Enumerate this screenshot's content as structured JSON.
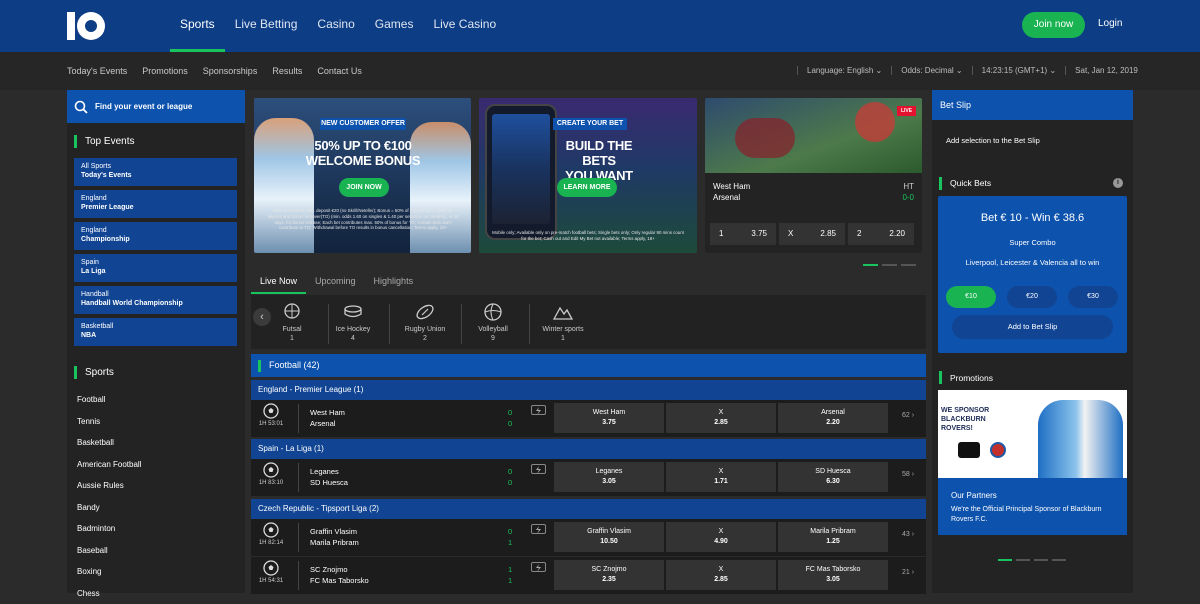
{
  "topbar": {
    "logo_text": "10 BET",
    "nav": [
      "Sports",
      "Live Betting",
      "Casino",
      "Games",
      "Live Casino"
    ],
    "join": "Join now",
    "login": "Login"
  },
  "subnav": {
    "links": [
      "Today's Events",
      "Promotions",
      "Sponsorships",
      "Results",
      "Contact Us"
    ],
    "language": "Language:  English",
    "odds": "Odds:  Decimal",
    "time": "14:23:15  (GMT+1)",
    "date": "Sat, Jan 12, 2019"
  },
  "left": {
    "search": "Find your event or league",
    "top_events_title": "Top Events",
    "events": [
      [
        "All Sports",
        "Today's Events"
      ],
      [
        "England",
        "Premier League"
      ],
      [
        "England",
        "Championship"
      ],
      [
        "Spain",
        "La Liga"
      ],
      [
        "Handball",
        "Handball World Championship"
      ],
      [
        "Basketball",
        "NBA"
      ]
    ],
    "sports_title": "Sports",
    "sports": [
      "Football",
      "Tennis",
      "Basketball",
      "American Football",
      "Aussie Rules",
      "Bandy",
      "Badminton",
      "Baseball",
      "Boxing",
      "Chess"
    ]
  },
  "banners": [
    {
      "tag": "NEW CUSTOMER OFFER",
      "h1": "50% UP TO €100",
      "h2": "WELCOME BONUS",
      "btn": "JOIN NOW",
      "fine": "New Customers; Min. deposit €20 (no Skrill/Neteller); Bonus = 50% of deposit up to €100; 6x deposit and bonus turnover(TO) (min. odds 1.60 on singles & 1.40 per selection on combos), in 30 days, for bonus release; Each bet contributes max. 50% of bonus for TO; Certain bets don't contribute to TO; Withdrawal before TO results in bonus cancellation; Terms apply, 18+"
    },
    {
      "tag": "CREATE YOUR BET",
      "h1": "BUILD THE BETS",
      "h2": "YOU WANT",
      "btn": "LEARN MORE",
      "fine": "Mobile only; Available only on pre-match football bets; Single bets only; Only regular 90 mins count for the bet; Cash out and Edit My Bet not available; Terms apply, 18+"
    }
  ],
  "live_card": {
    "badge": "LIVE",
    "home": "West Ham",
    "away": "Arsenal",
    "status": "HT",
    "score": "0-0",
    "odds": [
      [
        "1",
        "3.75"
      ],
      [
        "X",
        "2.85"
      ],
      [
        "2",
        "2.20"
      ]
    ]
  },
  "tabs": [
    "Live Now",
    "Upcoming",
    "Highlights"
  ],
  "sports_bar": [
    [
      "Futsal",
      "1"
    ],
    [
      "Ice Hockey",
      "4"
    ],
    [
      "Rugby Union",
      "2"
    ],
    [
      "Volleyball",
      "9"
    ],
    [
      "Winter sports",
      "1"
    ]
  ],
  "football_header": "Football (42)",
  "groups": [
    "England - Premier League (1)",
    "Spain - La Liga (1)",
    "Czech Republic - Tipsport Liga (2)"
  ],
  "matches": [
    {
      "time": "1H 53:01",
      "home": "West Ham",
      "away": "Arsenal",
      "sh": "0",
      "sa": "0",
      "o1": [
        "West Ham",
        "3.75"
      ],
      "ox": [
        "X",
        "2.85"
      ],
      "o2": [
        "Arsenal",
        "2.20"
      ],
      "more": "62 ›"
    },
    {
      "time": "1H 83:10",
      "home": "Leganes",
      "away": "SD Huesca",
      "sh": "0",
      "sa": "0",
      "o1": [
        "Leganes",
        "3.05"
      ],
      "ox": [
        "X",
        "1.71"
      ],
      "o2": [
        "SD Huesca",
        "6.30"
      ],
      "more": "58 ›"
    },
    {
      "time": "1H 82:14",
      "home": "Graffin Vlasim",
      "away": "Marila Pribram",
      "sh": "0",
      "sa": "1",
      "o1": [
        "Graffin Vlasim",
        "10.50"
      ],
      "ox": [
        "X",
        "4.90"
      ],
      "o2": [
        "Marila Pribram",
        "1.25"
      ],
      "more": "43 ›"
    },
    {
      "time": "1H 54:31",
      "home": "SC Znojmo",
      "away": "FC Mas Taborsko",
      "sh": "1",
      "sa": "1",
      "o1": [
        "SC Znojmo",
        "2.35"
      ],
      "ox": [
        "X",
        "2.85"
      ],
      "o2": [
        "FC Mas Taborsko",
        "3.05"
      ],
      "more": "21 ›"
    }
  ],
  "right": {
    "betslip": "Bet Slip",
    "add_sel": "Add selection to the Bet Slip",
    "quick": "Quick Bets",
    "info": "i",
    "qb_title": "Bet € 10 - Win € 38.6",
    "qb_sub": "Super Combo",
    "qb_desc": "Liverpool, Leicester & Valencia all to win",
    "stakes": [
      "€10",
      "€20",
      "€30"
    ],
    "add_btn": "Add to Bet Slip",
    "promos": "Promotions",
    "promo_tagline": "WE SPONSOR BLACKBURN ROVERS!",
    "partners_title": "Our Partners",
    "partners_text": "We're the Official Principal Sponsor of Blackburn Rovers F.C."
  },
  "colors": {
    "topbar": "#0d3d85",
    "accent_green": "#19c35d",
    "blue_tile": "#114594",
    "bright_blue": "#0d52ad",
    "live_red": "#e4122e"
  }
}
